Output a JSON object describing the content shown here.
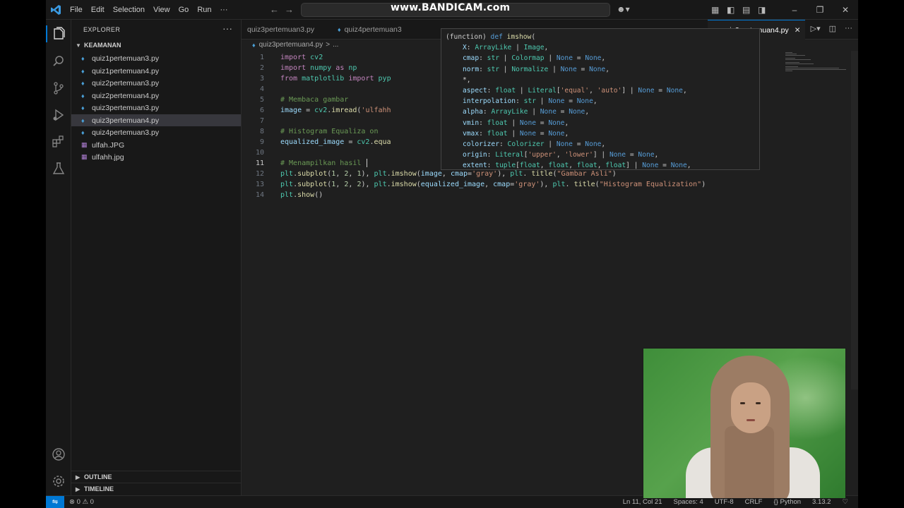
{
  "window": {
    "watermark": "www.BANDICAM.com",
    "menu": [
      "File",
      "Edit",
      "Selection",
      "View",
      "Go",
      "Run",
      "···"
    ]
  },
  "sidebar": {
    "header": "EXPLORER",
    "more": "···",
    "folder": "KEAMANAN",
    "files": [
      {
        "name": "quiz1pertemuan3.py",
        "type": "py",
        "selected": false
      },
      {
        "name": "quiz1pertemuan4.py",
        "type": "py",
        "selected": false
      },
      {
        "name": "quiz2pertemuan3.py",
        "type": "py",
        "selected": false
      },
      {
        "name": "quiz2pertemuan4.py",
        "type": "py",
        "selected": false
      },
      {
        "name": "quiz3pertemuan3.py",
        "type": "py",
        "selected": false
      },
      {
        "name": "quiz3pertemuan4.py",
        "type": "py",
        "selected": true
      },
      {
        "name": "quiz4pertemuan3.py",
        "type": "py",
        "selected": false
      },
      {
        "name": "ulfah.JPG",
        "type": "img",
        "selected": false
      },
      {
        "name": "ulfahh.jpg",
        "type": "img",
        "selected": false
      }
    ],
    "outline": "OUTLINE",
    "timeline": "TIMELINE"
  },
  "tabs": [
    {
      "label": "quiz3pertemuan3.py",
      "active": false
    },
    {
      "label": "quiz4pertemuan3",
      "active": false
    },
    {
      "label": "quiz3pertemuan4.py",
      "active": true
    }
  ],
  "breadcrumb": {
    "file": "quiz3pertemuan4.py",
    "sep": ">",
    "rest": "..."
  },
  "editor": {
    "current_line": 11,
    "lines": [
      "import cv2",
      "import numpy as np",
      "from matplotlib import pyp",
      "",
      "# Membaca gambar",
      "image = cv2.imread('ulfahh",
      "",
      "# Histogram Equaliza on",
      "equalized_image = cv2.equa",
      "",
      "# Menampilkan hasil ",
      "plt.subplot(1, 2, 1), plt.imshow(image, cmap='gray'), plt. title(\"Gambar Asli\")",
      "plt.subplot(1, 2, 2), plt.imshow(equalized_image, cmap='gray'), plt. title(\"Histogram Equalization\")",
      "plt.show()"
    ]
  },
  "hover": {
    "lines": [
      "(function) def imshow(",
      "X: ArrayLike | Image,",
      "cmap: str | Colormap | None = None,",
      "norm: str | Normalize | None = None,",
      "*,",
      "aspect: float | Literal['equal', 'auto'] | None = None,",
      "interpolation: str | None = None,",
      "alpha: ArrayLike | None = None,",
      "vmin: float | None = None,",
      "vmax: float | None = None,",
      "colorizer: Colorizer | None = None,",
      "origin: Literal['upper', 'lower'] | None = None,",
      "extent: tuple[float, float, float, float] | None = None,"
    ]
  },
  "statusbar": {
    "problems": "⊗ 0 ⚠ 0",
    "position": "Ln 11, Col 21",
    "spaces": "Spaces: 4",
    "encoding": "UTF-8",
    "eol": "CRLF",
    "language": "{} Python",
    "version": "3.13.2"
  },
  "colors": {
    "accent": "#0078d4",
    "background": "#1f1f1f",
    "webcam_bg": "#4f9a45"
  }
}
